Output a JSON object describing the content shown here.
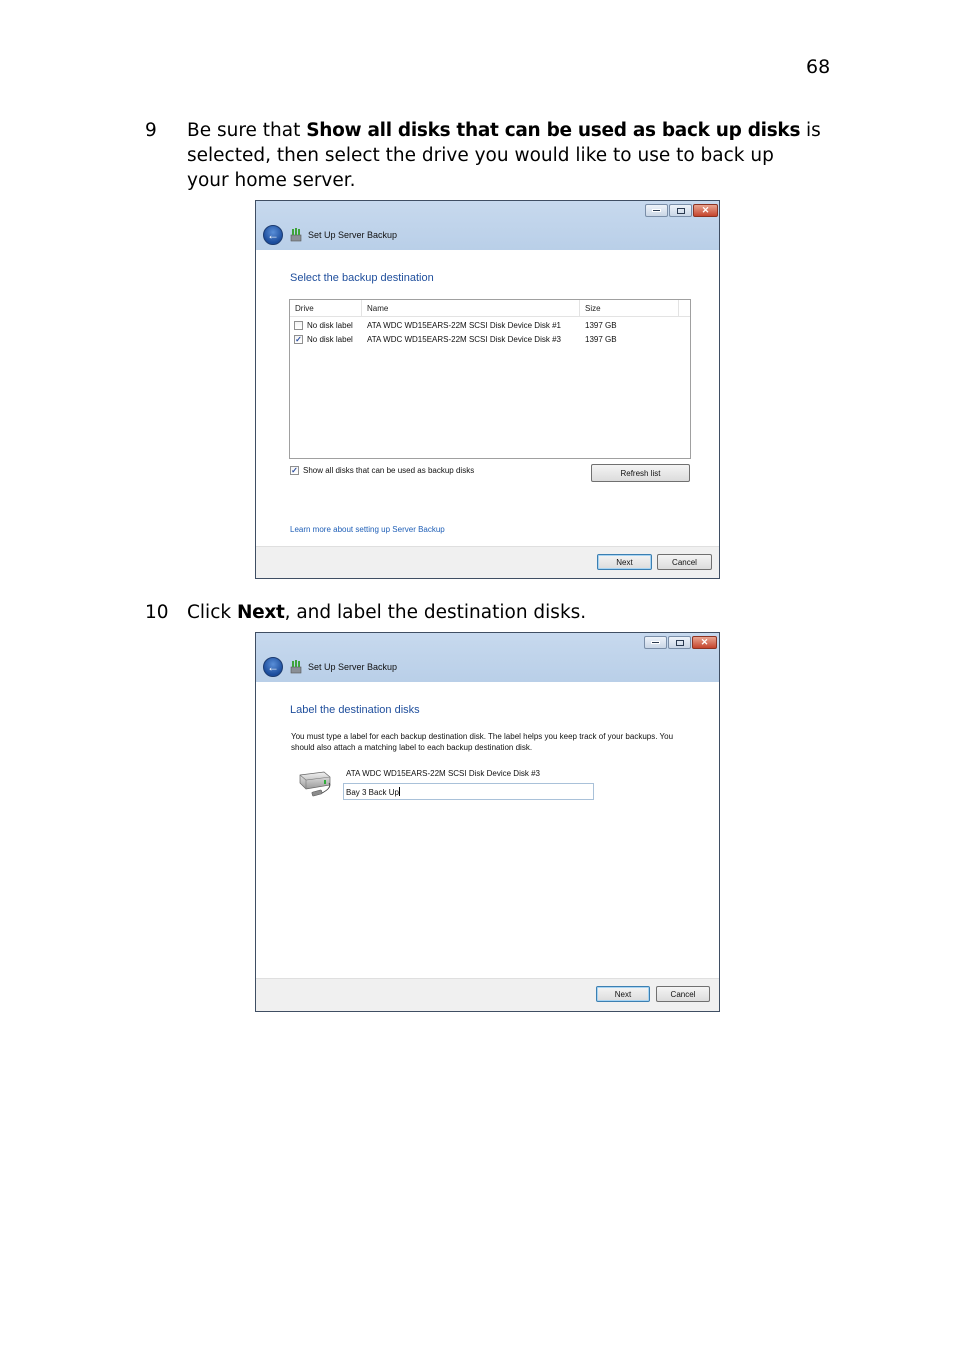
{
  "page": {
    "number": "68"
  },
  "steps": [
    {
      "number": "9",
      "text_pre": "Be sure that ",
      "text_bold": "Show all disks that can be used as back up disks",
      "text_post_line1": " is",
      "line2": "selected, then select the drive you would like to use to back up",
      "line3": "your home server."
    },
    {
      "number": "10",
      "text_pre": "Click ",
      "text_bold": "Next",
      "text_post": ", and label the destination disks."
    }
  ],
  "window1": {
    "title": "Set Up Server Backup",
    "icons": {
      "back": "back-arrow-icon",
      "app": "server-backup-icon"
    },
    "heading": "Select the backup destination",
    "list": {
      "columns": [
        "Drive",
        "Name",
        "Size"
      ],
      "rows": [
        {
          "checked": false,
          "drive": "No disk label",
          "name": "ATA WDC WD15EARS-22M SCSI Disk Device Disk #1",
          "size": "1397 GB"
        },
        {
          "checked": true,
          "drive": "No disk label",
          "name": "ATA WDC WD15EARS-22M SCSI Disk Device Disk #3",
          "size": "1397 GB"
        }
      ]
    },
    "show_all_checkbox": {
      "label": "Show all disks that can be used as backup disks",
      "checked": true
    },
    "refresh_button": "Refresh list",
    "learn_more_link": "Learn more about setting up Server Backup",
    "next_button": "Next",
    "cancel_button": "Cancel"
  },
  "window2": {
    "title": "Set Up Server Backup",
    "heading": "Label the destination disks",
    "description": "You must type a label for each backup destination disk. The label helps you keep track of your backups. You should also attach a matching label to each backup destination disk.",
    "disk_name": "ATA WDC WD15EARS-22M SCSI Disk Device Disk #3",
    "label_value": "Bay 3 Back Up",
    "next_button": "Next",
    "cancel_button": "Cancel"
  }
}
